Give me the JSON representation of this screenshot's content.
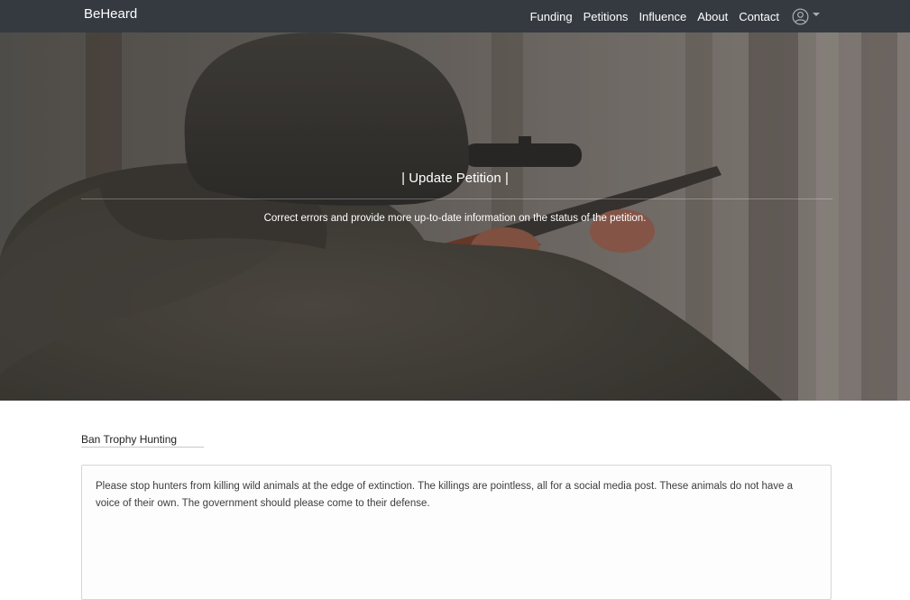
{
  "navbar": {
    "brand": "BeHeard",
    "links": [
      "Funding",
      "Petitions",
      "Influence",
      "About",
      "Contact"
    ],
    "user_icon": "user-circle-icon"
  },
  "hero": {
    "title": "| Update Petition |",
    "subtitle": "Correct errors and provide more up-to-date information on the status of the petition."
  },
  "form": {
    "title_value": "Ban Trophy Hunting",
    "description_value": "Please stop hunters from killing wild animals at the edge of extinction. The killings are pointless, all for a social media post. These animals do not have a voice of their own. The government should please come to their defense."
  },
  "colors": {
    "navbar_bg": "#343a40",
    "hero_overlay": "#2f2f2c"
  }
}
